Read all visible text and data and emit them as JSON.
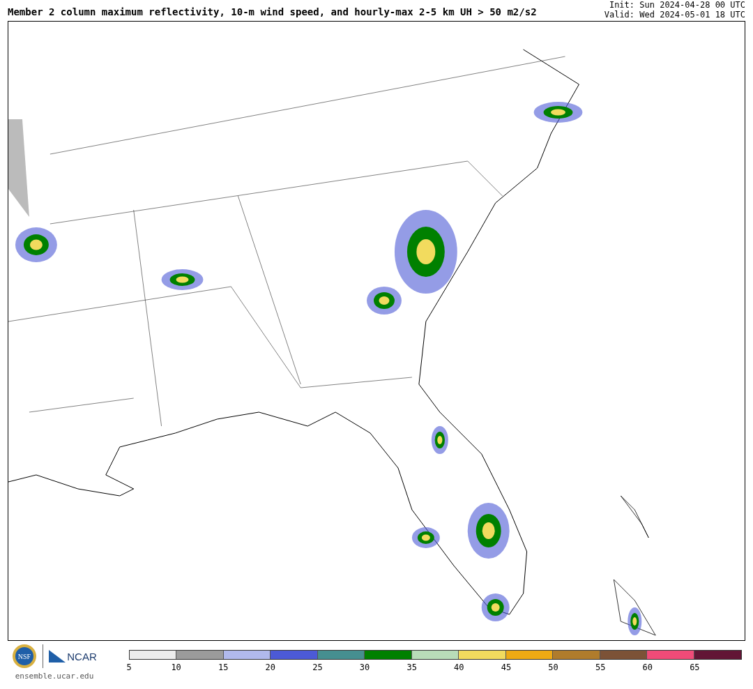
{
  "title": "Member 2 column maximum reflectivity, 10-m wind speed, and hourly-max 2-5 km UH > 50 m2/s2",
  "init": "Init: Sun 2024-04-28 00 UTC",
  "valid": "Valid: Wed 2024-05-01 18 UTC",
  "logos": {
    "nsf": "NSF",
    "ncar": "NCAR"
  },
  "site": "ensemble.ucar.edu",
  "colorbar": {
    "bins": [
      {
        "label": "5",
        "color": "#ececec"
      },
      {
        "label": "10",
        "color": "#9b9b9b"
      },
      {
        "label": "15",
        "color": "#b1b9ec"
      },
      {
        "label": "20",
        "color": "#4c5ad6"
      },
      {
        "label": "25",
        "color": "#468f90"
      },
      {
        "label": "30",
        "color": "#008000"
      },
      {
        "label": "35",
        "color": "#b8dcb8"
      },
      {
        "label": "40",
        "color": "#f2db5e"
      },
      {
        "label": "45",
        "color": "#eeaa14"
      },
      {
        "label": "50",
        "color": "#b07c2c"
      },
      {
        "label": "55",
        "color": "#7c5237"
      },
      {
        "label": "60",
        "color": "#f04b78"
      },
      {
        "label": "65",
        "color": "#621535"
      }
    ]
  }
}
